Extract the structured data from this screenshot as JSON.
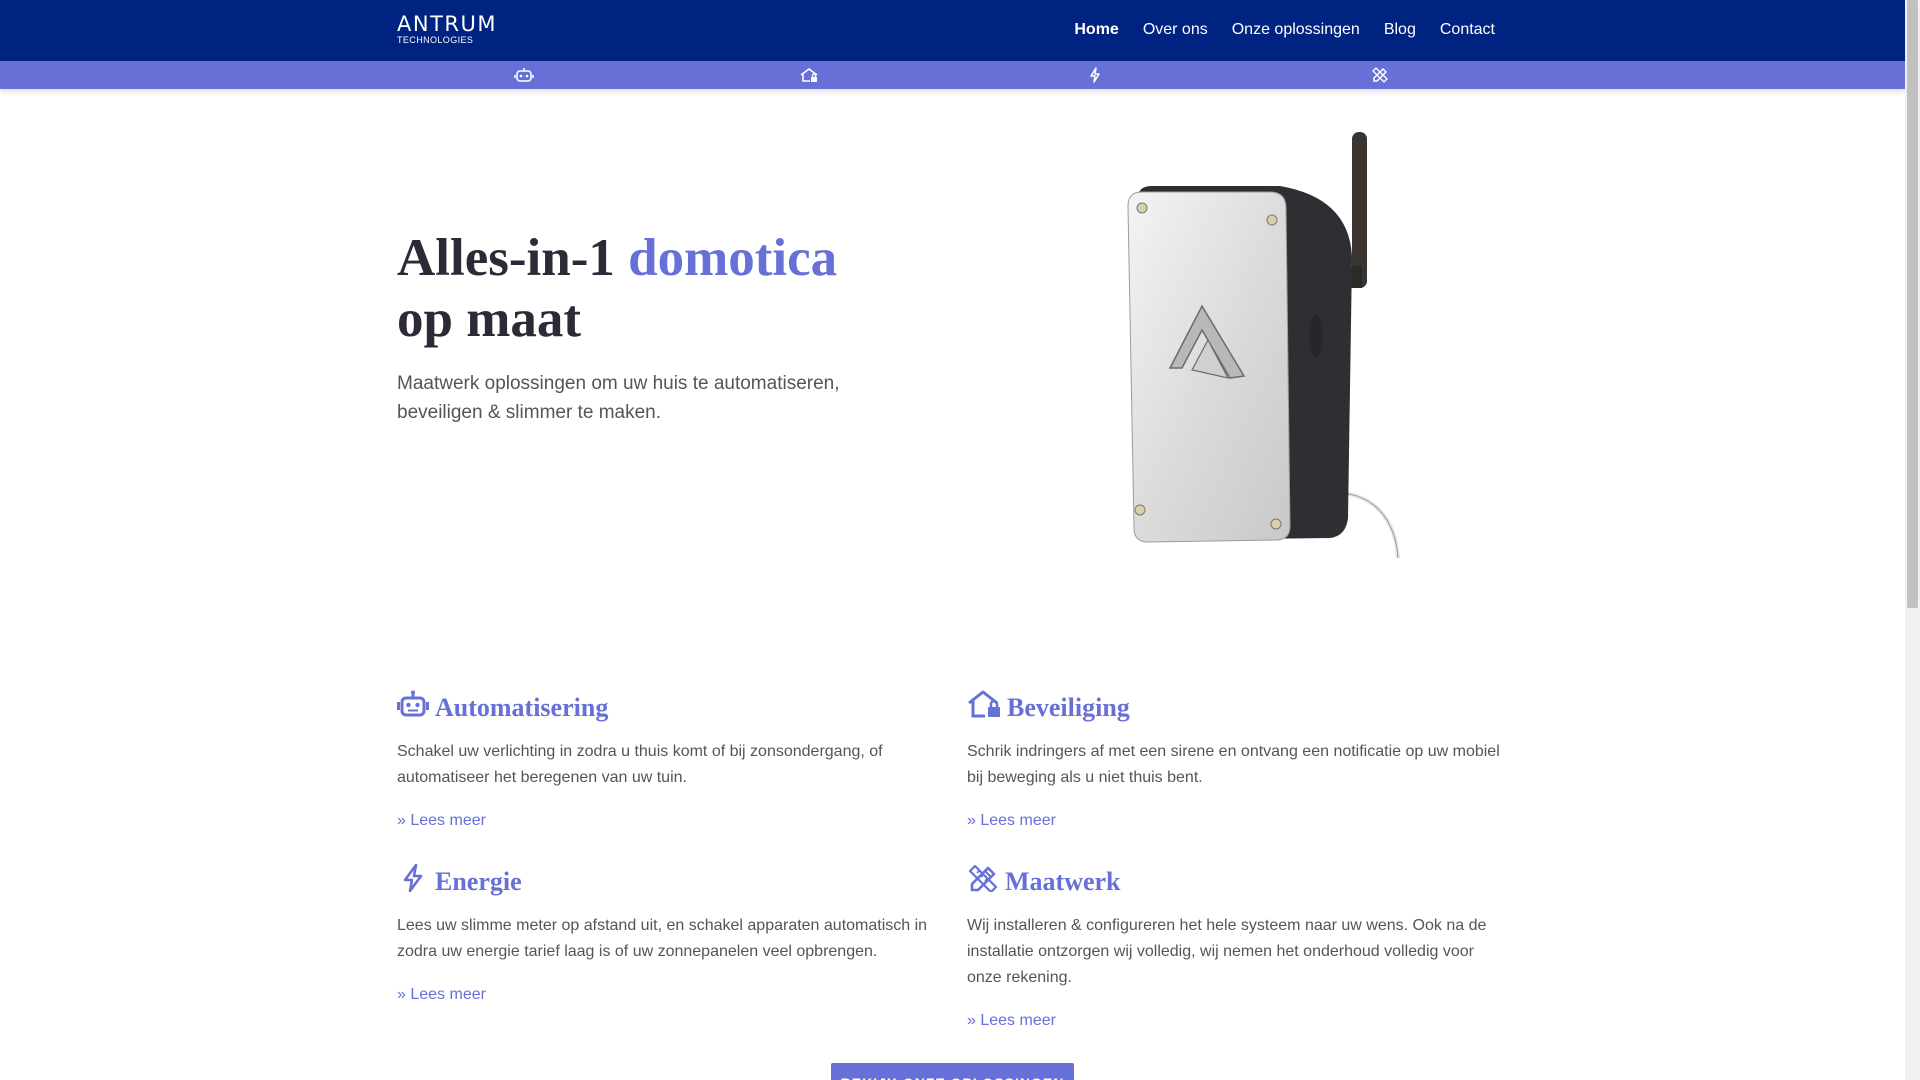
{
  "colors": {
    "nav_bg": "#002280",
    "accent": "#6670d6",
    "heading_dark": "#2b2b38",
    "body_text": "#555555"
  },
  "logo": {
    "name": "ANTRUM",
    "tagline": "TECHNOLOGIES"
  },
  "nav": {
    "items": [
      {
        "label": "Home",
        "active": true
      },
      {
        "label": "Over ons"
      },
      {
        "label": "Onze oplossingen"
      },
      {
        "label": "Blog"
      },
      {
        "label": "Contact"
      }
    ]
  },
  "icon_bar": {
    "icons": [
      "robot-icon",
      "home-lock-icon",
      "lightning-icon",
      "pencil-ruler-icon"
    ]
  },
  "hero": {
    "title_part1": "Alles-in-1 ",
    "title_accent": "domotica",
    "title_part2": "op maat",
    "subtitle": "Maatwerk oplossingen om uw huis te automatiseren, beveiligen & slimmer te maken.",
    "image": "antrum-device-with-antenna"
  },
  "features": [
    {
      "icon": "robot-icon",
      "title": "Automatisering",
      "text": "Schakel uw verlichting in zodra u thuis komt of bij zonsondergang, of automatiseer het beregenen van uw tuin.",
      "link": "» Lees meer"
    },
    {
      "icon": "home-lock-icon",
      "title": "Beveiliging",
      "text": "Schrik indringers af met een sirene en ontvang een notificatie op uw mobiel bij beweging als u niet thuis bent.",
      "link": "» Lees meer"
    },
    {
      "icon": "lightning-icon",
      "title": "Energie",
      "text": "Lees uw slimme meter op afstand uit, en schakel apparaten automatisch in zodra uw energie tarief laag is of uw zonnepanelen veel opbrengen.",
      "link": "» Lees meer"
    },
    {
      "icon": "pencil-ruler-icon",
      "title": "Maatwerk",
      "text": "Wij installeren & configureren het hele systeem naar uw wens. Ook na de installatie ontzorgen wij volledig, wij nemen het onderhoud volledig voor onze rekening.",
      "link": "» Lees meer"
    }
  ],
  "cta": {
    "label": "BEKIJK ONZE OPLOSSINGEN"
  }
}
